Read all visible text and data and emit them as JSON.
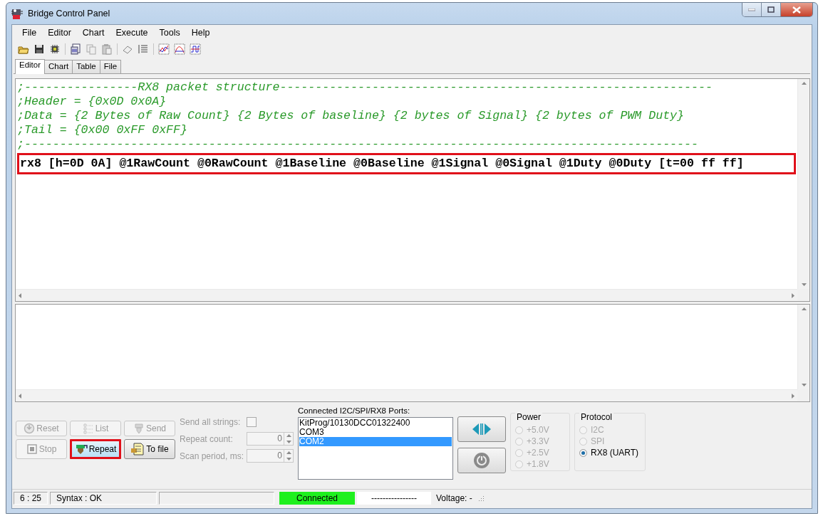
{
  "window": {
    "title": "Bridge Control Panel"
  },
  "menu": [
    {
      "label": "File"
    },
    {
      "label": "Editor"
    },
    {
      "label": "Chart"
    },
    {
      "label": "Execute"
    },
    {
      "label": "Tools"
    },
    {
      "label": "Help"
    }
  ],
  "tabs": [
    {
      "label": "Editor",
      "selected": true
    },
    {
      "label": "Chart",
      "selected": false
    },
    {
      "label": "Table",
      "selected": false
    },
    {
      "label": "File",
      "selected": false
    }
  ],
  "editor": {
    "lines": [
      {
        "kind": "comment",
        "text": ";----------------RX8 packet structure-------------------------------------------------------------",
        "highlighted": false
      },
      {
        "kind": "comment",
        "text": ";Header = {0x0D 0x0A}",
        "highlighted": false
      },
      {
        "kind": "comment",
        "text": ";Data = {2 Bytes of Raw Count} {2 Bytes of baseline} {2 bytes of Signal} {2 bytes of PWM Duty}",
        "highlighted": false
      },
      {
        "kind": "comment",
        "text": ";Tail = {0x00 0xFF 0xFF}",
        "highlighted": false
      },
      {
        "kind": "comment",
        "text": ";-----------------------------------------------------------------------------------------------",
        "highlighted": false
      },
      {
        "kind": "command",
        "text": "rx8 [h=0D 0A] @1RawCount @0RawCount @1Baseline @0Baseline @1Signal @0Signal @1Duty @0Duty [t=00 ff ff]",
        "highlighted": true
      }
    ]
  },
  "buttons": [
    {
      "label": "Reset",
      "disabled": true,
      "highlighted": false
    },
    {
      "label": "List",
      "disabled": true,
      "highlighted": false
    },
    {
      "label": "Send",
      "disabled": true,
      "highlighted": false
    },
    {
      "label": "Stop",
      "disabled": true,
      "highlighted": false
    },
    {
      "label": "Repeat",
      "disabled": false,
      "highlighted": true
    },
    {
      "label": "To file",
      "disabled": false,
      "highlighted": false
    }
  ],
  "settings": {
    "send_all_strings": {
      "label": "Send all strings:",
      "checked": false,
      "disabled": true
    },
    "repeat_count": {
      "label": "Repeat count:",
      "value": "0",
      "disabled": true
    },
    "scan_period": {
      "label": "Scan period, ms:",
      "value": "0",
      "disabled": true
    }
  },
  "ports": {
    "label": "Connected I2C/SPI/RX8 Ports:",
    "items": [
      {
        "text": "KitProg/10130DCC01322400",
        "selected": false
      },
      {
        "text": "COM3",
        "selected": false
      },
      {
        "text": "COM2",
        "selected": true
      }
    ]
  },
  "power": {
    "title": "Power",
    "options": [
      {
        "label": "+5.0V",
        "selected": false,
        "disabled": true
      },
      {
        "label": "+3.3V",
        "selected": false,
        "disabled": true
      },
      {
        "label": "+2.5V",
        "selected": false,
        "disabled": true
      },
      {
        "label": "+1.8V",
        "selected": false,
        "disabled": true
      }
    ]
  },
  "protocol": {
    "title": "Protocol",
    "options": [
      {
        "label": "I2C",
        "selected": false,
        "disabled": true
      },
      {
        "label": "SPI",
        "selected": false,
        "disabled": true
      },
      {
        "label": "RX8 (UART)",
        "selected": true,
        "disabled": false
      }
    ]
  },
  "status_bar": [
    {
      "kind": "panel",
      "text": "6 : 25"
    },
    {
      "kind": "panel",
      "text": "Syntax : OK"
    },
    {
      "kind": "spacer"
    },
    {
      "kind": "connected",
      "text": "Connected"
    },
    {
      "kind": "field",
      "text": "----------------"
    },
    {
      "kind": "label",
      "text": "Voltage: -"
    }
  ]
}
